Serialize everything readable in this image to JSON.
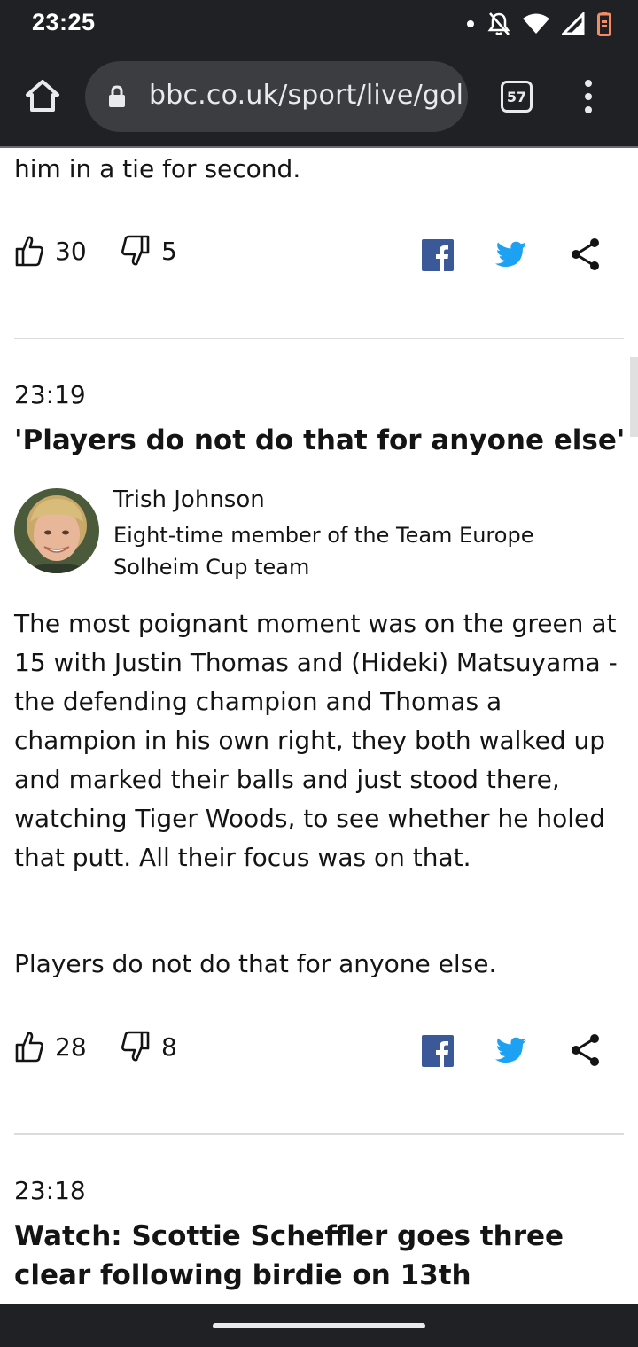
{
  "status_bar": {
    "time": "23:25",
    "icons": [
      "dot-icon",
      "bell-off-icon",
      "wifi-icon",
      "signal-icon",
      "battery-icon"
    ]
  },
  "browser": {
    "url": "bbc.co.uk/sport/live/gol",
    "tab_count": "57",
    "icons": [
      "home-icon",
      "lock-icon",
      "tabs-icon",
      "more-vert-icon"
    ]
  },
  "colors": {
    "facebook": "#3b5998",
    "twitter": "#1da1f2",
    "chrome_dark": "#202124",
    "text": "#141414"
  },
  "entries": [
    {
      "paragraphs": [
        "him in a tie for second."
      ],
      "likes": "30",
      "dislikes": "5"
    },
    {
      "time": "23:19",
      "headline": "'Players do not do that for anyone else'",
      "author": {
        "name": "Trish Johnson",
        "role": "Eight-time member of the Team Europe Solheim Cup team"
      },
      "paragraphs": [
        "The most poignant moment was on the green at 15 with Justin Thomas and (Hideki) Matsuyama - the defending champion and Thomas a champion in his own right, they both walked up and marked their balls and just stood there, watching Tiger Woods, to see whether he holed that putt. All their focus was on that.",
        "Players do not do that for anyone else."
      ],
      "likes": "28",
      "dislikes": "8"
    },
    {
      "time": "23:18",
      "headline": "Watch: Scottie Scheffler goes three clear following birdie on 13th"
    }
  ]
}
